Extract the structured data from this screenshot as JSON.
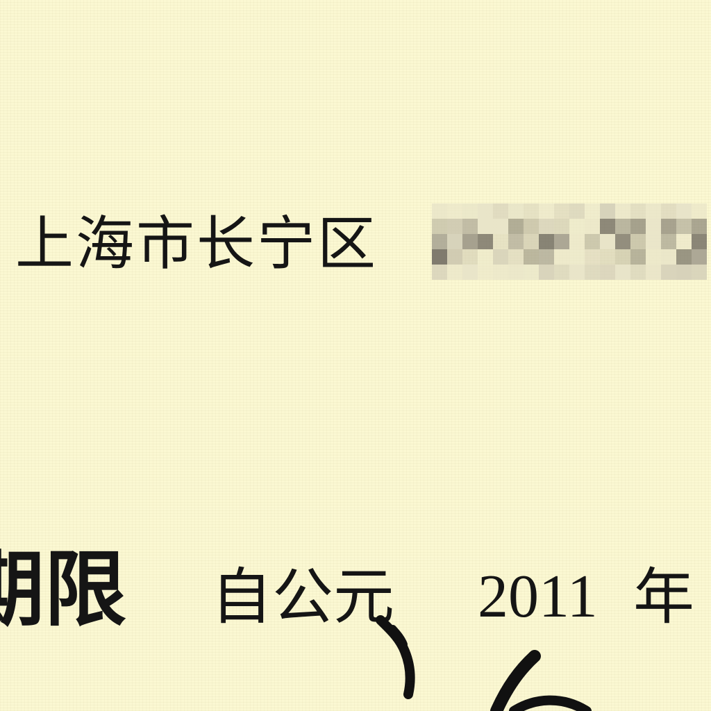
{
  "address": {
    "text": "上海市长宁区"
  },
  "term": {
    "label": "期限",
    "from_text": "自公元",
    "year_value": "2011",
    "year_unit": "年"
  },
  "colors": {
    "paper": "#fbf8d2",
    "ink": "#151515"
  }
}
